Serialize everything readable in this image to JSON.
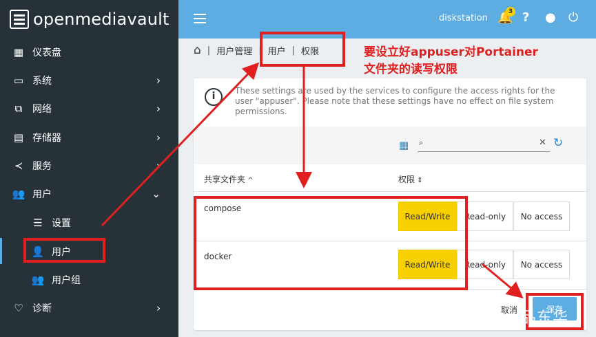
{
  "brand": {
    "name": "openmediavault"
  },
  "sidebar": {
    "items": [
      {
        "label": "仪表盘",
        "icon": "dashboard-icon",
        "glyph": "▦",
        "chevron": ""
      },
      {
        "label": "系统",
        "icon": "laptop-icon",
        "glyph": "▭",
        "chevron": "›"
      },
      {
        "label": "网络",
        "icon": "network-icon",
        "glyph": "⧉",
        "chevron": "›"
      },
      {
        "label": "存储器",
        "icon": "storage-icon",
        "glyph": "▤",
        "chevron": "›"
      },
      {
        "label": "服务",
        "icon": "share-icon",
        "glyph": "≺",
        "chevron": "›"
      },
      {
        "label": "用户",
        "icon": "users-icon",
        "glyph": "👥",
        "chevron": "⌄"
      }
    ],
    "sub_items": [
      {
        "label": "设置",
        "icon": "settings-sliders-icon",
        "glyph": "☰"
      },
      {
        "label": "用户",
        "icon": "user-icon",
        "glyph": "👤"
      },
      {
        "label": "用户组",
        "icon": "user-group-icon",
        "glyph": "👥"
      }
    ],
    "diag": {
      "label": "诊断",
      "icon": "heartbeat-icon",
      "glyph": "♡",
      "chevron": "›"
    }
  },
  "topbar": {
    "host": "diskstation",
    "notifications": "3",
    "help": "?",
    "user": "●",
    "power": "⏻"
  },
  "breadcrumb": {
    "home": "⌂",
    "items": [
      "用户管理",
      "用户",
      "权限"
    ]
  },
  "info": {
    "text": "These settings are used by the services to configure the access rights for the user \"appuser\". Please note that these settings have no effect on file system permissions."
  },
  "table": {
    "col_folder": "共享文件夹",
    "col_perm": "权限",
    "rows": [
      {
        "name": "compose",
        "rw": "Read/Write",
        "ro": "Read-only",
        "na": "No access"
      },
      {
        "name": "docker",
        "rw": "Read/Write",
        "ro": "Read-only",
        "na": "No access"
      }
    ]
  },
  "actions": {
    "cancel": "取消",
    "save": "保存"
  },
  "annotation": {
    "line1": "要设立好appuser对Portainer",
    "line2": "文件夹的读写权限"
  },
  "watermark": "知乎 @一品东华",
  "colors": {
    "accent": "#5dade2",
    "sidebar": "#263238",
    "selected": "#f9d100",
    "annotation": "#e02020"
  }
}
